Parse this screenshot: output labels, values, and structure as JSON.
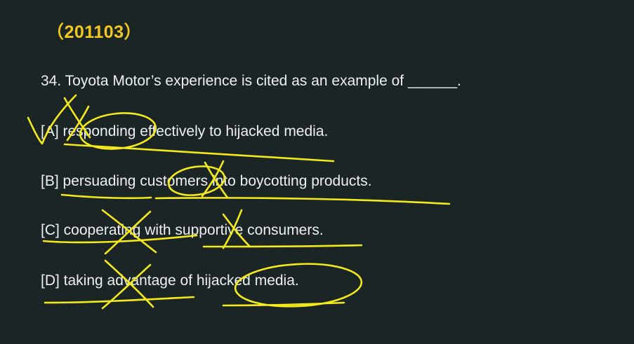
{
  "slide": {
    "code": "（201103）",
    "question": "34. Toyota Motor’s experience is cited as an example of ______.",
    "options": [
      {
        "text": "[A] responding effectively to hijacked media."
      },
      {
        "text": "[B] persuading customers into boycotting products."
      },
      {
        "text": "[C] cooperating with supportive consumers."
      },
      {
        "text": "[D] taking advantage of hijacked media."
      }
    ]
  },
  "colors": {
    "background": "#1c2526",
    "text": "#eef0f0",
    "code": "#f2c81e",
    "annotation_ink": "#f4ea1a"
  }
}
